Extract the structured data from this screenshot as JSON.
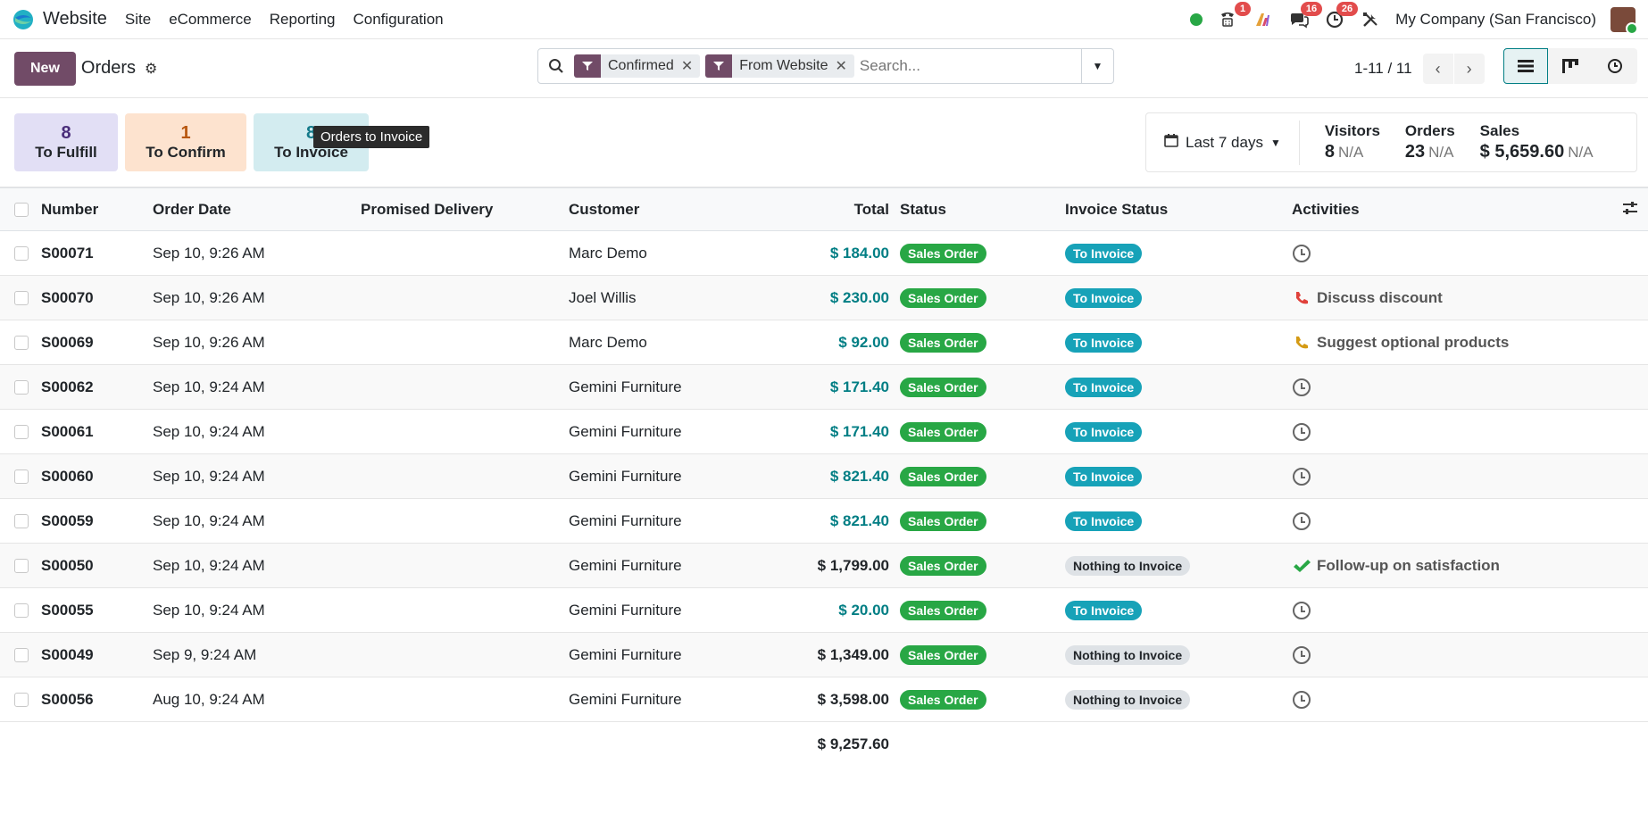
{
  "navbar": {
    "app_title": "Website",
    "menu": [
      "Site",
      "eCommerce",
      "Reporting",
      "Configuration"
    ],
    "badges": {
      "phone": "1",
      "chat": "16",
      "activities": "26"
    },
    "company": "My Company (San Francisco)"
  },
  "control": {
    "new_label": "New",
    "breadcrumb": "Orders",
    "facets": [
      "Confirmed",
      "From Website"
    ],
    "search_placeholder": "Search...",
    "pager": "1-11 / 11"
  },
  "tiles": [
    {
      "count": "8",
      "label": "To Fulfill"
    },
    {
      "count": "1",
      "label": "To Confirm"
    },
    {
      "count": "8",
      "label": "To Invoice"
    }
  ],
  "tooltip": "Orders to Invoice",
  "stats": {
    "period": "Last 7 days",
    "items": [
      {
        "label": "Visitors",
        "value": "8",
        "na": "N/A"
      },
      {
        "label": "Orders",
        "value": "23",
        "na": "N/A"
      },
      {
        "label": "Sales",
        "value": "$ 5,659.60",
        "na": "N/A"
      }
    ]
  },
  "table": {
    "headers": [
      "Number",
      "Order Date",
      "Promised Delivery",
      "Customer",
      "Total",
      "Status",
      "Invoice Status",
      "Activities"
    ],
    "rows": [
      {
        "number": "S00071",
        "date": "Sep 10, 9:26 AM",
        "customer": "Marc Demo",
        "total": "$ 184.00",
        "total_style": "blue",
        "status": "Sales Order",
        "invoice": "To Invoice",
        "activity": "",
        "activity_icon": "clock-icon"
      },
      {
        "number": "S00070",
        "date": "Sep 10, 9:26 AM",
        "customer": "Joel Willis",
        "total": "$ 230.00",
        "total_style": "blue",
        "status": "Sales Order",
        "invoice": "To Invoice",
        "activity": "Discuss discount",
        "activity_icon": "phone-red-icon"
      },
      {
        "number": "S00069",
        "date": "Sep 10, 9:26 AM",
        "customer": "Marc Demo",
        "total": "$ 92.00",
        "total_style": "blue",
        "status": "Sales Order",
        "invoice": "To Invoice",
        "activity": "Suggest optional products",
        "activity_icon": "phone-orange-icon"
      },
      {
        "number": "S00062",
        "date": "Sep 10, 9:24 AM",
        "customer": "Gemini Furniture",
        "total": "$ 171.40",
        "total_style": "blue",
        "status": "Sales Order",
        "invoice": "To Invoice",
        "activity": "",
        "activity_icon": "clock-icon"
      },
      {
        "number": "S00061",
        "date": "Sep 10, 9:24 AM",
        "customer": "Gemini Furniture",
        "total": "$ 171.40",
        "total_style": "blue",
        "status": "Sales Order",
        "invoice": "To Invoice",
        "activity": "",
        "activity_icon": "clock-icon"
      },
      {
        "number": "S00060",
        "date": "Sep 10, 9:24 AM",
        "customer": "Gemini Furniture",
        "total": "$ 821.40",
        "total_style": "blue",
        "status": "Sales Order",
        "invoice": "To Invoice",
        "activity": "",
        "activity_icon": "clock-icon"
      },
      {
        "number": "S00059",
        "date": "Sep 10, 9:24 AM",
        "customer": "Gemini Furniture",
        "total": "$ 821.40",
        "total_style": "blue",
        "status": "Sales Order",
        "invoice": "To Invoice",
        "activity": "",
        "activity_icon": "clock-icon"
      },
      {
        "number": "S00050",
        "date": "Sep 10, 9:24 AM",
        "customer": "Gemini Furniture",
        "total": "$ 1,799.00",
        "total_style": "black",
        "status": "Sales Order",
        "invoice": "Nothing to Invoice",
        "activity": "Follow-up on satisfaction",
        "activity_icon": "check-icon"
      },
      {
        "number": "S00055",
        "date": "Sep 10, 9:24 AM",
        "customer": "Gemini Furniture",
        "total": "$ 20.00",
        "total_style": "blue",
        "status": "Sales Order",
        "invoice": "To Invoice",
        "activity": "",
        "activity_icon": "clock-icon"
      },
      {
        "number": "S00049",
        "date": "Sep 9, 9:24 AM",
        "customer": "Gemini Furniture",
        "total": "$ 1,349.00",
        "total_style": "black",
        "status": "Sales Order",
        "invoice": "Nothing to Invoice",
        "activity": "",
        "activity_icon": "clock-icon"
      },
      {
        "number": "S00056",
        "date": "Aug 10, 9:24 AM",
        "customer": "Gemini Furniture",
        "total": "$ 3,598.00",
        "total_style": "black",
        "status": "Sales Order",
        "invoice": "Nothing to Invoice",
        "activity": "",
        "activity_icon": "clock-icon"
      }
    ],
    "footer_total": "$ 9,257.60"
  },
  "colors": {
    "brand": "#714b67",
    "link": "#017e84",
    "success": "#28a745",
    "info": "#17a2b8"
  }
}
